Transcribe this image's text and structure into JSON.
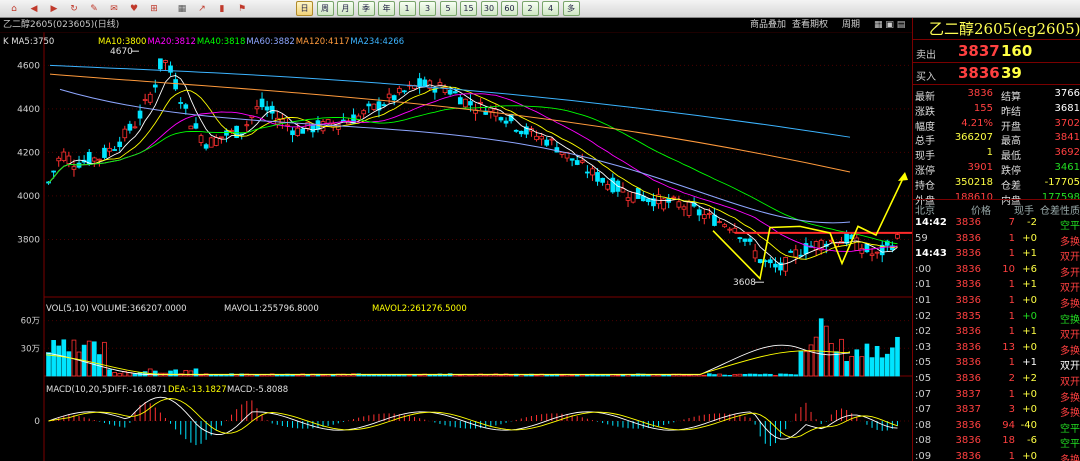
{
  "toolbar": {
    "icon_buttons": [
      "home-icon",
      "back-icon",
      "forward-icon",
      "refresh-icon",
      "draw-icon",
      "alert-icon",
      "favorite-icon",
      "indicator-icon",
      "table-icon",
      "line-chart-icon",
      "candle-icon",
      "flag-icon"
    ],
    "periods": [
      "日",
      "周",
      "月",
      "季",
      "年",
      "1",
      "3",
      "5",
      "15",
      "30",
      "60",
      "2",
      "4",
      "多"
    ],
    "selected_period": "日"
  },
  "header": {
    "symbol_line": "乙二醇2605(023605)(日线)",
    "buttons": [
      "商品叠加",
      "查看期权",
      "周期"
    ]
  },
  "main_chart": {
    "ma_label": "K  MA5:3750",
    "ma_values": [
      {
        "label": "MA10:3800",
        "color": "#ffff00"
      },
      {
        "label": "MA20:3812",
        "color": "#ff00ff"
      },
      {
        "label": "MA40:3818",
        "color": "#00ff00"
      },
      {
        "label": "MA60:3882",
        "color": "#8ea6ff"
      },
      {
        "label": "MA120:4117",
        "color": "#ff9a3c"
      },
      {
        "label": "MA234:4266",
        "color": "#3cb4ff"
      }
    ],
    "y_ticks": [
      "4600",
      "4400",
      "4200",
      "4000",
      "3800"
    ],
    "high_label": "4670",
    "low_label": "3608"
  },
  "volume_panel": {
    "label": "VOL(5,10)  VOLUME:366207.0000",
    "mavol1": "MAVOL1:255796.8000",
    "mavol2": "MAVOL2:261276.5000",
    "ticks": [
      "60万",
      "30万"
    ]
  },
  "macd_panel": {
    "label": "MACD(10,20,5)",
    "diff": "DIFF:-16.0871",
    "dea": "DEA:-13.1827",
    "macd": "MACD:-5.8088",
    "tick": "0"
  },
  "quote": {
    "title": "乙二醇2605(eg2605)",
    "ask_label": "卖出",
    "ask_price": "3837",
    "ask_vol": "160",
    "bid_label": "买入",
    "bid_price": "3836",
    "bid_vol": "39",
    "stats": [
      {
        "k1": "最新",
        "v1": "3836",
        "c1": "#ff4040",
        "k2": "结算",
        "v2": "3766",
        "c2": "#ffffff"
      },
      {
        "k1": "涨跌",
        "v1": "155",
        "c1": "#ff4040",
        "k2": "昨结",
        "v2": "3681",
        "c2": "#ffffff"
      },
      {
        "k1": "幅度",
        "v1": "4.21%",
        "c1": "#ff4040",
        "k2": "开盘",
        "v2": "3702",
        "c2": "#ff4040"
      },
      {
        "k1": "总手",
        "v1": "366207",
        "c1": "#ffff44",
        "k2": "最高",
        "v2": "3841",
        "c2": "#ff4040"
      },
      {
        "k1": "现手",
        "v1": "1",
        "c1": "#ffff44",
        "k2": "最低",
        "v2": "3692",
        "c2": "#ff4040"
      },
      {
        "k1": "涨停",
        "v1": "3901",
        "c1": "#ff4040",
        "k2": "跌停",
        "v2": "3461",
        "c2": "#22dd22"
      },
      {
        "k1": "持仓",
        "v1": "350218",
        "c1": "#ffff44",
        "k2": "仓差",
        "v2": "-17705",
        "c2": "#ffff44"
      },
      {
        "k1": "外盘",
        "v1": "188610",
        "c1": "#ff4040",
        "k2": "内盘",
        "v2": "177598",
        "c2": "#22dd22"
      }
    ],
    "ticks_header": [
      "北京",
      "价格",
      "现手",
      "仓差",
      "性质"
    ],
    "ticks": [
      {
        "t": "14:42",
        "p": "3836",
        "h": "7",
        "d": "-2",
        "n": "空平",
        "nc": "#22dd22",
        "dc": "#ffff44"
      },
      {
        "t": "59",
        "p": "3836",
        "h": "1",
        "d": "+0",
        "n": "多换",
        "nc": "#ff4040",
        "dc": "#ffff44"
      },
      {
        "t": "14:43",
        "p": "3836",
        "h": "1",
        "d": "+1",
        "n": "双开",
        "nc": "#ff4040",
        "dc": "#ffff44"
      },
      {
        "t": ":00",
        "p": "3836",
        "h": "10",
        "d": "+6",
        "n": "多开",
        "nc": "#ff4040",
        "dc": "#ffff44"
      },
      {
        "t": ":01",
        "p": "3836",
        "h": "1",
        "d": "+1",
        "n": "双开",
        "nc": "#ff4040",
        "dc": "#ffff44"
      },
      {
        "t": ":01",
        "p": "3836",
        "h": "1",
        "d": "+0",
        "n": "多换",
        "nc": "#ff4040",
        "dc": "#ffff44"
      },
      {
        "t": ":02",
        "p": "3835",
        "h": "1",
        "d": "+0",
        "n": "空换",
        "nc": "#22dd22",
        "dc": "#22dd22"
      },
      {
        "t": ":02",
        "p": "3836",
        "h": "1",
        "d": "+1",
        "n": "双开",
        "nc": "#ff4040",
        "dc": "#ffff44"
      },
      {
        "t": ":03",
        "p": "3836",
        "h": "13",
        "d": "+0",
        "n": "多换",
        "nc": "#ff4040",
        "dc": "#ffff44"
      },
      {
        "t": ":05",
        "p": "3836",
        "h": "1",
        "d": "+1",
        "n": "双开",
        "nc": "#ffffff",
        "dc": "#ffffff"
      },
      {
        "t": ":05",
        "p": "3836",
        "h": "2",
        "d": "+2",
        "n": "双开",
        "nc": "#ff4040",
        "dc": "#ffff44"
      },
      {
        "t": ":07",
        "p": "3837",
        "h": "1",
        "d": "+0",
        "n": "多换",
        "nc": "#ff4040",
        "dc": "#ffff44"
      },
      {
        "t": ":07",
        "p": "3837",
        "h": "3",
        "d": "+0",
        "n": "多换",
        "nc": "#ff4040",
        "dc": "#ffff44"
      },
      {
        "t": ":08",
        "p": "3836",
        "h": "94",
        "d": "-40",
        "n": "空平",
        "nc": "#22dd22",
        "dc": "#ffff44"
      },
      {
        "t": ":08",
        "p": "3836",
        "h": "18",
        "d": "-6",
        "n": "空平",
        "nc": "#22dd22",
        "dc": "#ffff44"
      },
      {
        "t": ":09",
        "p": "3836",
        "h": "1",
        "d": "+0",
        "n": "多换",
        "nc": "#ff4040",
        "dc": "#ffff44"
      }
    ]
  },
  "colors": {
    "up": "#ff3030",
    "down": "#00e5ff",
    "panel_border": "#7a0000",
    "grid": "#5a0000"
  }
}
